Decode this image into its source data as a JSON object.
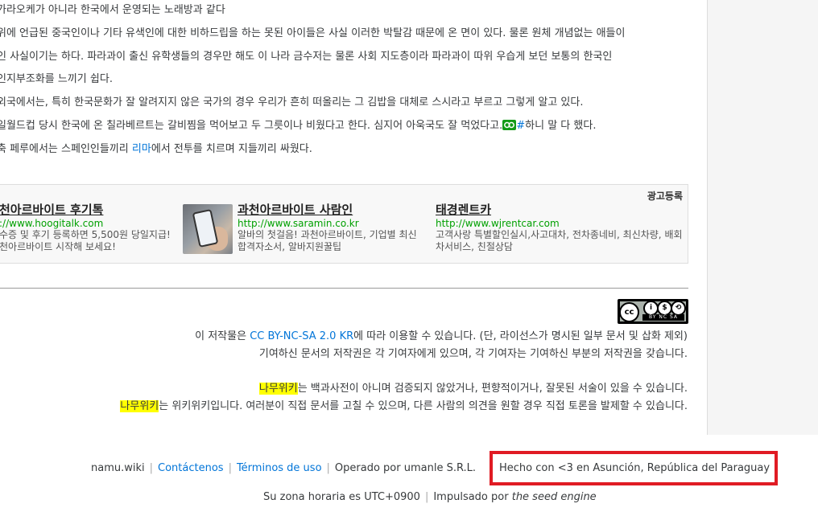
{
  "article": {
    "lines": [
      {
        "text": "가라오케가 아니라 한국에서 운영되는 노래방과 같다"
      },
      {
        "text": "위에 언급된 중국인이나 기타 유색인에 대한 비하드립을 하는 못된 아이들은 사실 이러한 박탈감 때문에 온 면이 있다. 물론 원체 개념없는 애들이"
      },
      {
        "text": "인 사실이기는 하다. 파라과이 출신 유학생들의 경우만 해도 이 나라 금수저는 물론 사회 지도층이라 파라과이 따위 우습게 보던 보통의 한국인"
      },
      {
        "text": "인지부조화를 느끼기 쉽다."
      }
    ],
    "line5": "외국에서는, 특히 한국문화가 잘 알려지지 않은 국가의 경우 우리가 흔히 떠올리는 그 김밥을 대체로 스시라고 부르고 그렇게 알고 있다.",
    "line6_before": "일월드컵 당시 한국에 온 칠라베르트는 갈비찜을 먹어보고 두 그릇이나 비웠다고 한다. 심지어 아욱국도 잘 먹었다고.",
    "line6_link": "#",
    "line6_after": "하니 말 다 했다.",
    "line7_before": "축 페루에서는 스페인인들끼리 ",
    "line7_link": "리마",
    "line7_after": "에서 전투를 치르며 지들끼리 싸웠다."
  },
  "ads": {
    "label": "광고등록",
    "items": [
      {
        "title": "천아르바이트 후기톡",
        "url": "://www.hoogitalk.com",
        "desc": "수증 및 후기 등록하면 5,500원 당일지급! 천아르바이트 시작해 보세요!"
      },
      {
        "title": "과천아르바이트 사람인",
        "url": "http://www.saramin.co.kr",
        "desc": "알바의 첫걸음! 과천아르바이트, 기업별 최신 합격자소서, 알바지원꿀팁"
      },
      {
        "title": "태경렌트카",
        "url": "http://www.wjrentcar.com",
        "desc": "고객사랑 특별할인실시,사고대차, 전차종네비, 최신차량, 배회차서비스, 친절상담"
      }
    ]
  },
  "license": {
    "cc_badge_text": "BY NC SA",
    "cc_symbols": [
      "cc",
      "i",
      "$",
      "⟲"
    ],
    "line1_link": "CC BY-NC-SA 2.0 KR",
    "line1_before": "이 저작물은 ",
    "line1_after": "에 따라 이용할 수 있습니다. (단, 라이선스가 명시된 일부 문서 및 삽화 제외)",
    "line2": "기여하신 문서의 저작권은 각 기여자에게 있으며, 각 기여자는 기여하신 부분의 저작권을 갖습니다.",
    "line3_mark": "나무위키",
    "line3_rest": "는 백과사전이 아니며 검증되지 않았거나, 편향적이거나, 잘못된 서술이 있을 수 있습니다.",
    "line4_mark": "나무위키",
    "line4_rest": "는 위키위키입니다. 여러분이 직접 문서를 고칠 수 있으며, 다른 사람의 의견을 원할 경우 직접 토론을 발제할 수 있습니다."
  },
  "footer": {
    "site": "namu.wiki",
    "contact": "Contáctenos",
    "terms": "Términos de uso",
    "operated": "Operado por umanle S.R.L.",
    "made_in": "Hecho con <3 en Asunción, República del Paraguay",
    "timezone": "Su zona horaria es UTC+0900",
    "powered_before": "Impulsado por ",
    "engine": "the seed engine",
    "separator": "|"
  },
  "colors": {
    "link": "#0275d8",
    "highlight": "#ffff00",
    "ad_url": "#00a000",
    "annotation_box": "#e01b24",
    "ext_icon": "#139a17"
  }
}
